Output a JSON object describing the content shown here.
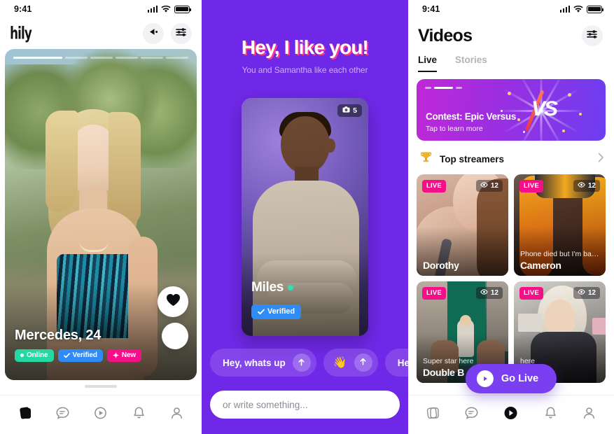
{
  "status_bar": {
    "time": "9:41"
  },
  "phone1": {
    "logo": "hily",
    "header_icons": [
      {
        "name": "rewind-icon",
        "label": "rewind"
      },
      {
        "name": "filters-icon",
        "label": "filters"
      }
    ],
    "story_segments": {
      "total": 6,
      "active_index": 0
    },
    "card": {
      "name": "Mercedes, 24",
      "badges": [
        {
          "label": "Online",
          "color": "#25d8a1",
          "icon": "dot"
        },
        {
          "label": "Verified",
          "color": "#2f8bf5",
          "icon": "check"
        },
        {
          "label": "New",
          "color": "#f5108a",
          "icon": "spark"
        }
      ],
      "like_button": "like",
      "secondary_button": "super-like"
    },
    "tabbar": [
      {
        "name": "tab-cards",
        "icon": "cards-icon",
        "active": true
      },
      {
        "name": "tab-messages",
        "icon": "chat-icon",
        "active": false
      },
      {
        "name": "tab-videos",
        "icon": "play-icon",
        "active": false
      },
      {
        "name": "tab-notifications",
        "icon": "bell-icon",
        "active": false
      },
      {
        "name": "tab-profile",
        "icon": "person-icon",
        "active": false
      }
    ]
  },
  "phone2": {
    "title": "Hey, I like you!",
    "subtitle": "You and Samantha like each other",
    "background_color": "#7028e8",
    "title_shadow_color": "#ff3b8e",
    "card": {
      "name": "Miles",
      "online": true,
      "verified_label": "Verified",
      "photo_count": "5",
      "camera_icon": "camera-icon"
    },
    "chips": [
      {
        "label": "Hey, whats up",
        "send_icon": "arrow-up-icon"
      },
      {
        "label": "👋",
        "send_icon": "arrow-up-icon",
        "emoji": true
      },
      {
        "label": "Hey",
        "send_icon": "arrow-up-icon"
      }
    ],
    "input": {
      "placeholder": "or write something..."
    }
  },
  "phone3": {
    "title": "Videos",
    "filter_icon": "filters-icon",
    "tabs": [
      {
        "label": "Live",
        "active": true
      },
      {
        "label": "Stories",
        "active": false
      }
    ],
    "banner": {
      "title": "Contest: Epic Versus",
      "subtitle": "Tap to learn more",
      "vs_text": "VS",
      "dots": 3,
      "active_dot": 1
    },
    "section": {
      "icon": "trophy-icon",
      "label": "Top streamers",
      "chevron": "chevron-right-icon"
    },
    "tiles": [
      {
        "name": "Dorothy",
        "subtitle": "",
        "live": "LIVE",
        "viewers": "12"
      },
      {
        "name": "Cameron",
        "subtitle": "Phone died but I'm back l...",
        "live": "LIVE",
        "viewers": "12"
      },
      {
        "name": "Double B",
        "subtitle": "Super star here",
        "live": "LIVE",
        "viewers": "12"
      },
      {
        "name": "",
        "subtitle": "here",
        "live": "LIVE",
        "viewers": "12"
      }
    ],
    "go_live": {
      "label": "Go Live",
      "icon": "play-icon",
      "color": "#7b3ff2"
    },
    "tabbar": [
      {
        "name": "tab-cards",
        "icon": "cards-icon",
        "active": false
      },
      {
        "name": "tab-messages",
        "icon": "chat-icon",
        "active": false
      },
      {
        "name": "tab-videos",
        "icon": "play-icon",
        "active": true
      },
      {
        "name": "tab-notifications",
        "icon": "bell-icon",
        "active": false
      },
      {
        "name": "tab-profile",
        "icon": "person-icon",
        "active": false
      }
    ]
  }
}
